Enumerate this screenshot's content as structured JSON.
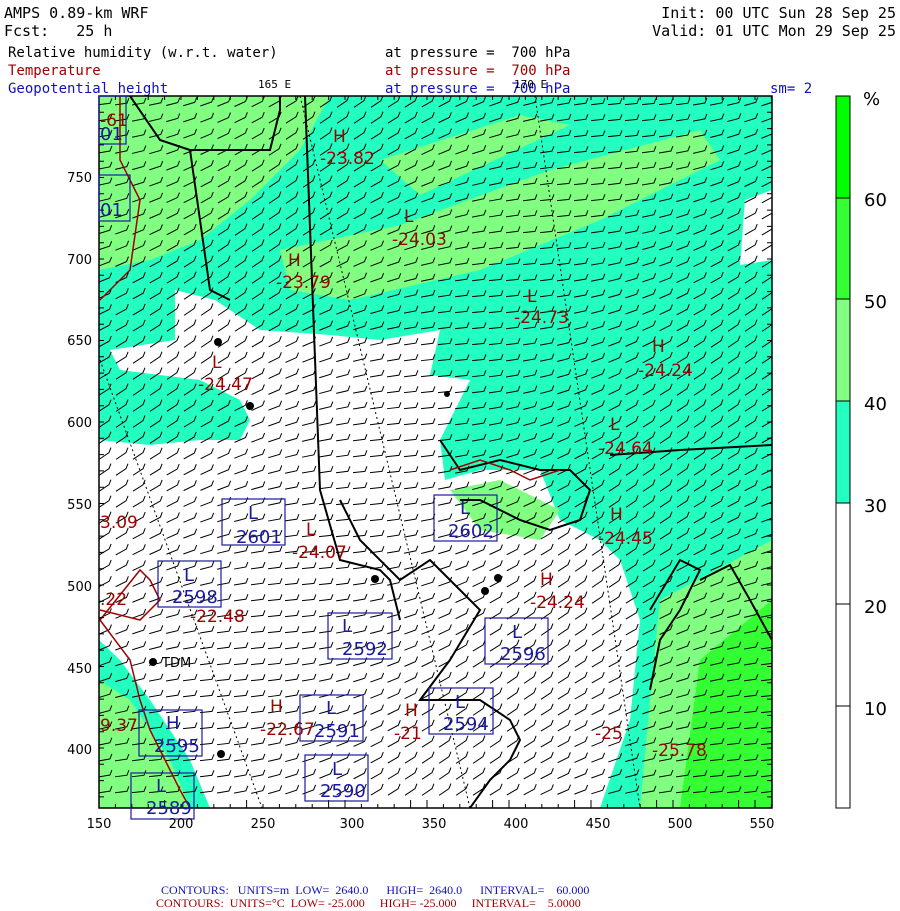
{
  "header": {
    "model": "AMPS 0.89-km WRF",
    "forecast": "Fcst:   25 h",
    "init": "Init: 00 UTC Sun 28 Sep 25",
    "valid": "Valid: 01 UTC Mon 29 Sep 25",
    "fields": [
      {
        "name": "Relative humidity (w.r.t. water)",
        "level": "at pressure =  700 hPa"
      },
      {
        "name": "Temperature",
        "level": "at pressure =  700 hPa"
      },
      {
        "name": "Geopotential height",
        "level": "at pressure =  700 hPa"
      }
    ],
    "smoothing": "sm= 2",
    "lon_labels": [
      "165 E",
      "170 E"
    ]
  },
  "axes": {
    "x_ticks": [
      "150",
      "200",
      "250",
      "300",
      "350",
      "400",
      "450",
      "500",
      "550"
    ],
    "y_ticks": [
      "750",
      "700",
      "650",
      "600",
      "550",
      "500",
      "450",
      "400"
    ]
  },
  "colorbar": {
    "unit": "%",
    "labels": [
      "60",
      "50",
      "40",
      "30",
      "20",
      "10"
    ],
    "colors": {
      "60+": "#00ff00",
      "50-60": "#33ff33",
      "40-50": "#80ff80",
      "30-40": "#22ffc0",
      "below30": "#ffffff"
    }
  },
  "station": "TDM",
  "temperature_labels": [
    {
      "mark": "H",
      "value": "-23.82"
    },
    {
      "mark": "L",
      "value": "-24.03"
    },
    {
      "mark": "H",
      "value": "-23.79"
    },
    {
      "mark": "L",
      "value": "-24.73"
    },
    {
      "mark": "H",
      "value": "-24.24"
    },
    {
      "mark": "L",
      "value": "-24.47"
    },
    {
      "mark": "L",
      "value": "-24.64"
    },
    {
      "mark": "H",
      "value": "-24.45"
    },
    {
      "mark": "H",
      "value": "-24.24"
    },
    {
      "mark": "L",
      "value": "-24.07"
    },
    {
      "mark": "",
      "value": "-22.48"
    },
    {
      "mark": "H",
      "value": "-22.67"
    },
    {
      "mark": "H",
      "value": "-21"
    },
    {
      "mark": "",
      "value": "-25"
    },
    {
      "mark": "",
      "value": "-25.78"
    },
    {
      "mark": "",
      "value": "3.09"
    },
    {
      "mark": "",
      "value": ".22"
    },
    {
      "mark": "",
      "value": "9.37"
    },
    {
      "mark": "",
      "value": "-61"
    }
  ],
  "height_labels": [
    {
      "mark": "L",
      "value": "2601"
    },
    {
      "mark": "L",
      "value": "2598"
    },
    {
      "mark": "L",
      "value": "2592"
    },
    {
      "mark": "L",
      "value": "2591"
    },
    {
      "mark": "L",
      "value": "2590"
    },
    {
      "mark": "L",
      "value": "2589"
    },
    {
      "mark": "H",
      "value": "2595"
    },
    {
      "mark": "L",
      "value": "2594"
    },
    {
      "mark": "L",
      "value": "2596"
    },
    {
      "mark": "L",
      "value": "2602"
    },
    {
      "mark": "",
      "value": "01"
    },
    {
      "mark": "",
      "value": "01"
    }
  ],
  "footer": {
    "height": {
      "contours": "CONTOURS:",
      "units": "UNITS=m",
      "low": "LOW=  2640.0",
      "high": "HIGH=  2640.0",
      "interval": "INTERVAL=    60.000"
    },
    "temperature": {
      "contours": "CONTOURS:",
      "units": "UNITS=°C",
      "low": "LOW= -25.000",
      "high": "HIGH= -25.000",
      "interval": "INTERVAL=    5.0000"
    }
  }
}
